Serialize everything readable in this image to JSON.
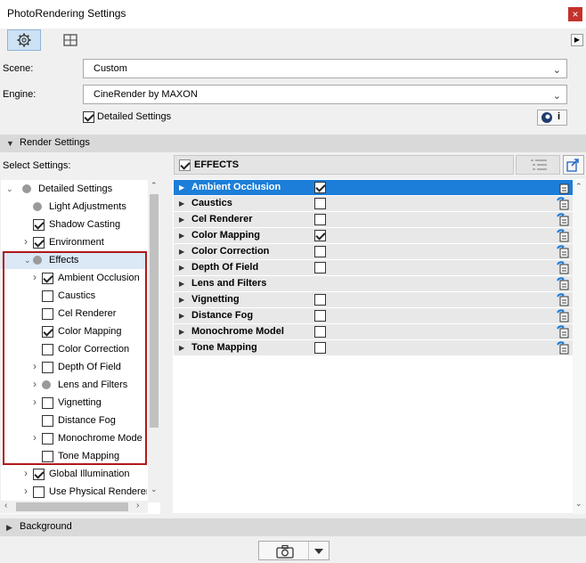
{
  "window": {
    "title": "PhotoRendering Settings",
    "close_glyph": "×"
  },
  "tabs": [
    {
      "icon": "gear-icon",
      "selected": true
    },
    {
      "icon": "grid-crosshair-icon",
      "selected": false
    }
  ],
  "tab_overflow_glyph": "▶",
  "scene": {
    "label": "Scene:",
    "value": "Custom"
  },
  "engine": {
    "label": "Engine:",
    "value": "CineRender by MAXON"
  },
  "detailed_settings": {
    "label": "Detailed Settings",
    "checked": true
  },
  "cinema_badge_text": "i",
  "render_settings_header": "Render Settings",
  "select_settings_label": "Select Settings:",
  "tree": [
    {
      "label": "Detailed Settings",
      "state": "dot",
      "expander": "open",
      "indent": 0
    },
    {
      "label": "Light Adjustments",
      "state": "dot",
      "expander": "none",
      "indent": 1
    },
    {
      "label": "Shadow Casting",
      "state": "checked",
      "expander": "none",
      "indent": 1
    },
    {
      "label": "Environment",
      "state": "checked",
      "expander": "closed",
      "indent": 1
    },
    {
      "label": "Effects",
      "state": "dot",
      "expander": "open",
      "indent": 1,
      "selected": true
    },
    {
      "label": "Ambient Occlusion",
      "state": "checked",
      "expander": "closed",
      "indent": 2
    },
    {
      "label": "Caustics",
      "state": "unchecked",
      "expander": "none",
      "indent": 2
    },
    {
      "label": "Cel Renderer",
      "state": "unchecked",
      "expander": "none",
      "indent": 2
    },
    {
      "label": "Color Mapping",
      "state": "checked",
      "expander": "none",
      "indent": 2
    },
    {
      "label": "Color Correction",
      "state": "unchecked",
      "expander": "none",
      "indent": 2
    },
    {
      "label": "Depth Of Field",
      "state": "unchecked",
      "expander": "closed",
      "indent": 2
    },
    {
      "label": "Lens and Filters",
      "state": "dot",
      "expander": "closed",
      "indent": 2
    },
    {
      "label": "Vignetting",
      "state": "unchecked",
      "expander": "closed",
      "indent": 2
    },
    {
      "label": "Distance Fog",
      "state": "unchecked",
      "expander": "none",
      "indent": 2
    },
    {
      "label": "Monochrome Mode",
      "state": "unchecked",
      "expander": "closed",
      "indent": 2
    },
    {
      "label": "Tone Mapping",
      "state": "unchecked",
      "expander": "none",
      "indent": 2
    },
    {
      "label": "Global Illumination",
      "state": "checked",
      "expander": "closed",
      "indent": 1
    },
    {
      "label": "Use Physical Renderer",
      "state": "unchecked",
      "expander": "closed",
      "indent": 1
    }
  ],
  "effects_header": {
    "label": "EFFECTS",
    "checked": true
  },
  "effects": [
    {
      "name": "Ambient Occlusion",
      "checkbox": true,
      "checked": true,
      "selected": true
    },
    {
      "name": "Caustics",
      "checkbox": true,
      "checked": false
    },
    {
      "name": "Cel Renderer",
      "checkbox": true,
      "checked": false
    },
    {
      "name": "Color Mapping",
      "checkbox": true,
      "checked": true
    },
    {
      "name": "Color Correction",
      "checkbox": true,
      "checked": false
    },
    {
      "name": "Depth Of Field",
      "checkbox": true,
      "checked": false
    },
    {
      "name": "Lens and Filters",
      "checkbox": false,
      "checked": false
    },
    {
      "name": "Vignetting",
      "checkbox": true,
      "checked": false
    },
    {
      "name": "Distance Fog",
      "checkbox": true,
      "checked": false
    },
    {
      "name": "Monochrome Model",
      "checkbox": true,
      "checked": false
    },
    {
      "name": "Tone Mapping",
      "checkbox": true,
      "checked": false
    }
  ],
  "background_header": "Background",
  "colors": {
    "accent": "#1c7ed8",
    "selected_tab": "#cde2f5",
    "highlight_box": "#b01818",
    "close": "#c4312b"
  }
}
